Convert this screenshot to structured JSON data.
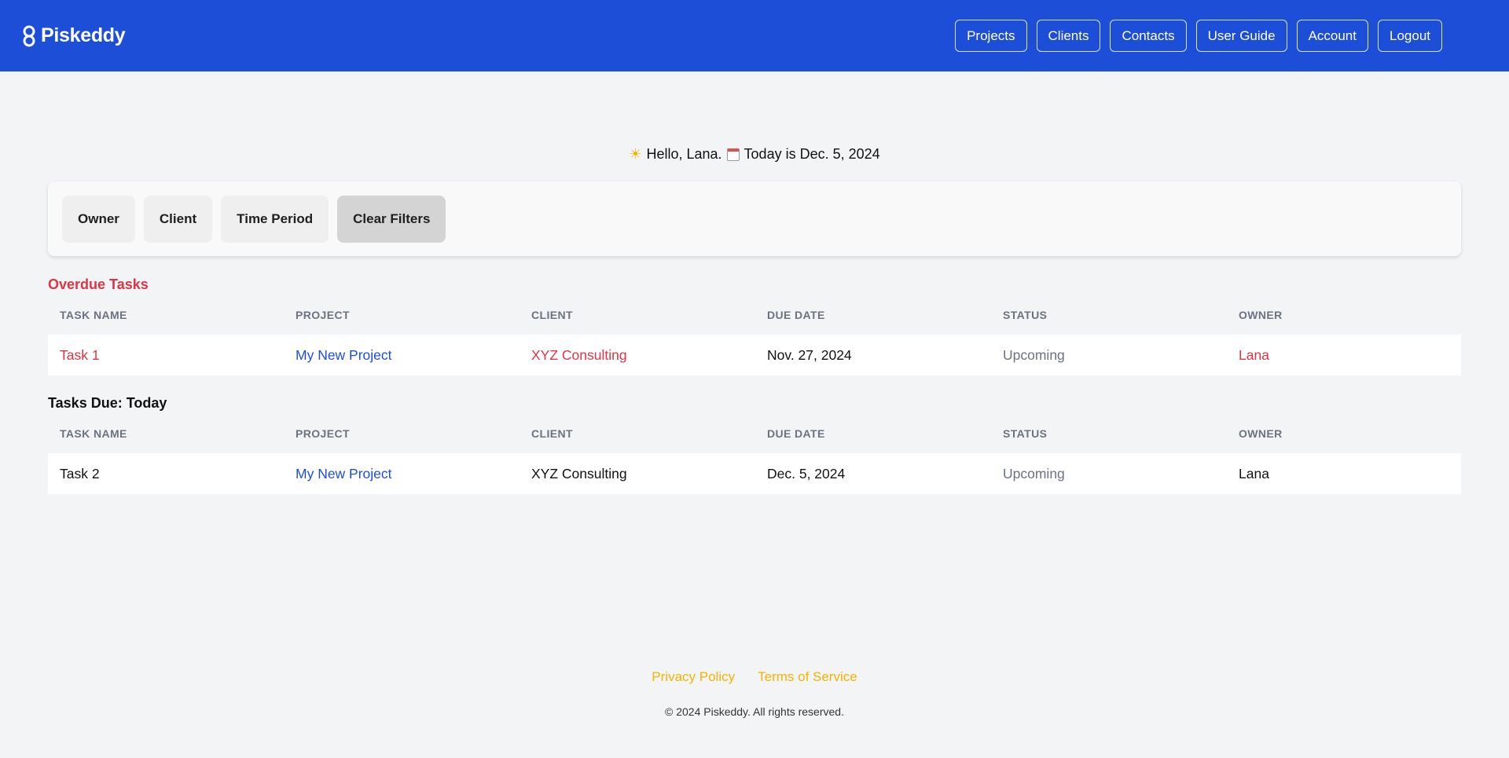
{
  "header": {
    "brand": "Piskeddy",
    "nav": [
      "Projects",
      "Clients",
      "Contacts",
      "User Guide",
      "Account",
      "Logout"
    ]
  },
  "greeting": {
    "hello": "Hello, Lana.",
    "today": "Today is Dec. 5, 2024"
  },
  "filters": {
    "owner": "Owner",
    "client": "Client",
    "time_period": "Time Period",
    "clear": "Clear Filters"
  },
  "columns": [
    "TASK NAME",
    "PROJECT",
    "CLIENT",
    "DUE DATE",
    "STATUS",
    "OWNER"
  ],
  "overdue": {
    "title": "Overdue Tasks",
    "rows": [
      {
        "task": "Task 1",
        "project": "My New Project",
        "client": "XYZ Consulting",
        "due": "Nov. 27, 2024",
        "status": "Upcoming",
        "owner": "Lana"
      }
    ]
  },
  "today": {
    "title": "Tasks Due: Today",
    "rows": [
      {
        "task": "Task 2",
        "project": "My New Project",
        "client": "XYZ Consulting",
        "due": "Dec. 5, 2024",
        "status": "Upcoming",
        "owner": "Lana"
      }
    ]
  },
  "footer": {
    "privacy": "Privacy Policy",
    "terms": "Terms of Service",
    "copyright": "© 2024 Piskeddy. All rights reserved."
  },
  "colors": {
    "header_bg": "#1d4ed8",
    "overdue_red": "#dc3545",
    "link_blue": "#1d4ed8",
    "footer_link": "#f5b301"
  }
}
